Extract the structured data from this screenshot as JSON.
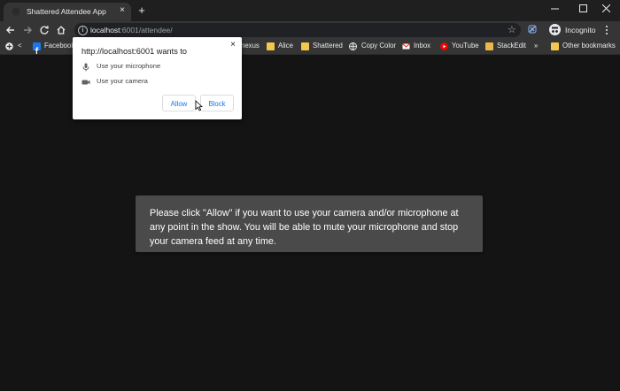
{
  "browser": {
    "tab": {
      "title": "Shattered Attendee App",
      "close": "×"
    },
    "new_tab": "+",
    "url": {
      "host": "localhost",
      "rest": ":6001/attendee/"
    },
    "incognito_label": "Incognito"
  },
  "bookmarks": {
    "apps_chevron": "<",
    "items": [
      {
        "label": "Facebook",
        "icon": "facebook-icon"
      },
      {
        "label": "nexus",
        "icon": "folder-icon"
      },
      {
        "label": "Alice",
        "icon": "folder-icon"
      },
      {
        "label": "Shattered",
        "icon": "folder-icon"
      },
      {
        "label": "Copy Color",
        "icon": "globe-icon"
      },
      {
        "label": "Inbox",
        "icon": "gmail-icon"
      },
      {
        "label": "YouTube",
        "icon": "youtube-icon"
      },
      {
        "label": "StackEdit",
        "icon": "stackedit-icon"
      }
    ],
    "overflow": "»",
    "other": "Other bookmarks"
  },
  "permission_prompt": {
    "title": "http://localhost:6001 wants to",
    "close": "×",
    "permissions": [
      {
        "label": "Use your microphone",
        "icon": "microphone-icon"
      },
      {
        "label": "Use your camera",
        "icon": "camera-icon"
      }
    ],
    "allow_label": "Allow",
    "block_label": "Block"
  },
  "page": {
    "notice": "Please click \"Allow\" if you want to use your camera and/or microphone at any point in the show. You will be able to mute your microphone and stop your camera feed at any time."
  },
  "colors": {
    "page_background": "#141414",
    "notice_background": "#4a4a4a",
    "link_blue": "#1a73e8",
    "toolbar": "#353535"
  }
}
